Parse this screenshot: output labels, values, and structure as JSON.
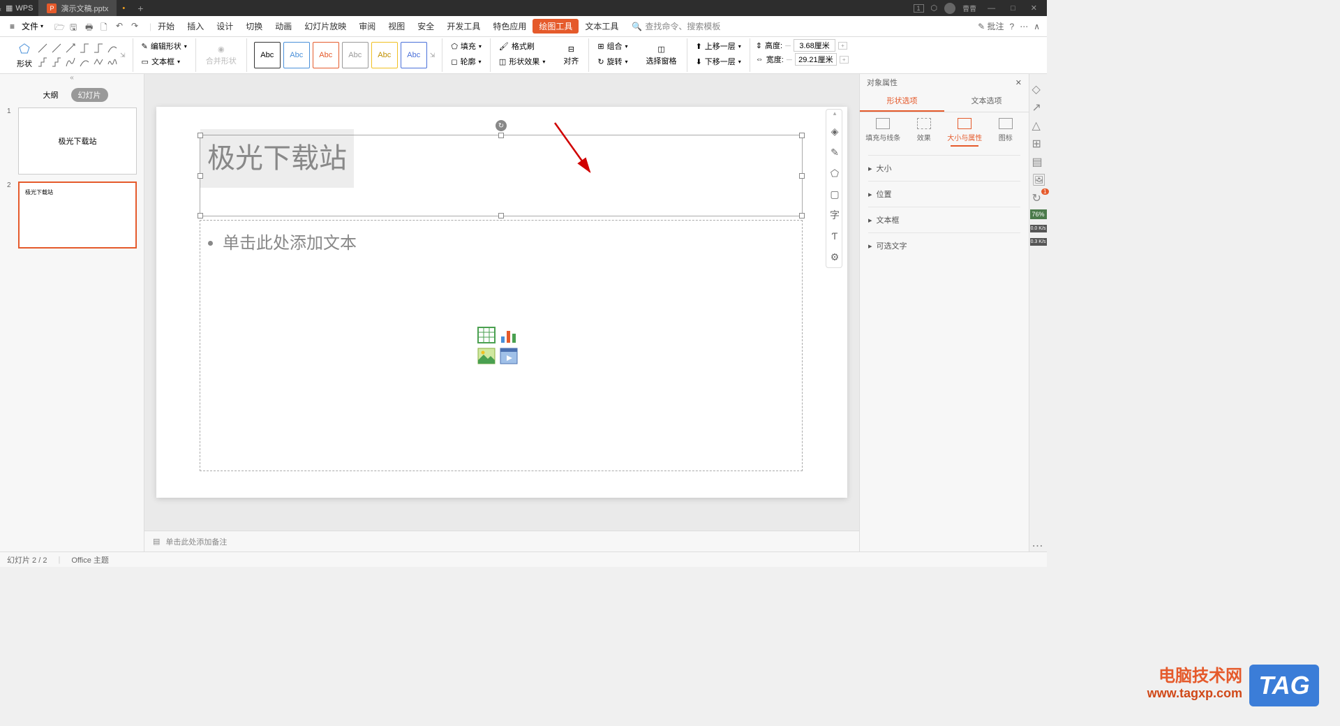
{
  "titlebar": {
    "app_name": "WPS",
    "tab_name": "演示文稿.pptx",
    "user_name": "曹曹"
  },
  "menubar": {
    "file": "文件",
    "items": [
      "开始",
      "插入",
      "设计",
      "切换",
      "动画",
      "幻灯片放映",
      "审阅",
      "视图",
      "安全",
      "开发工具",
      "特色应用",
      "绘图工具",
      "文本工具"
    ],
    "active_index": 11,
    "search_placeholder": "查找命令、搜索模板",
    "annotate": "批注"
  },
  "ribbon": {
    "shape": "形状",
    "edit_shape": "编辑形状",
    "textbox": "文本框",
    "merge_shapes": "合并形状",
    "abc": "Abc",
    "fill": "填充",
    "outline": "轮廓",
    "format_painter": "格式刷",
    "shape_effect": "形状效果",
    "align": "对齐",
    "group": "组合",
    "rotate": "旋转",
    "selection_pane": "选择窗格",
    "bring_forward": "上移一层",
    "send_backward": "下移一层",
    "height_label": "高度:",
    "height_value": "3.68厘米",
    "width_label": "宽度:",
    "width_value": "29.21厘米"
  },
  "slide_panel": {
    "outline": "大纲",
    "slides": "幻灯片",
    "slide1_title": "极光下载站",
    "slide2_title": "极光下载站"
  },
  "canvas": {
    "title_text": "极光下载站",
    "body_placeholder": "单击此处添加文本"
  },
  "notes": {
    "placeholder": "单击此处添加备注"
  },
  "right_panel": {
    "header": "对象属性",
    "tab_shape": "形状选项",
    "tab_text": "文本选项",
    "subtab_fill": "填充与线条",
    "subtab_effect": "效果",
    "subtab_size": "大小与属性",
    "subtab_chart": "图标",
    "section_size": "大小",
    "section_position": "位置",
    "section_textbox": "文本框",
    "section_alt": "可选文字"
  },
  "statusbar": {
    "slide_info": "幻灯片 2 / 2",
    "theme": "Office 主题"
  },
  "watermark": {
    "title": "电脑技术网",
    "url": "www.tagxp.com",
    "tag": "TAG"
  },
  "iconbar_stats": {
    "badge1": "1",
    "pct": "76%",
    "rate1": "0.0 K/s",
    "rate2": "0.3 K/s"
  }
}
